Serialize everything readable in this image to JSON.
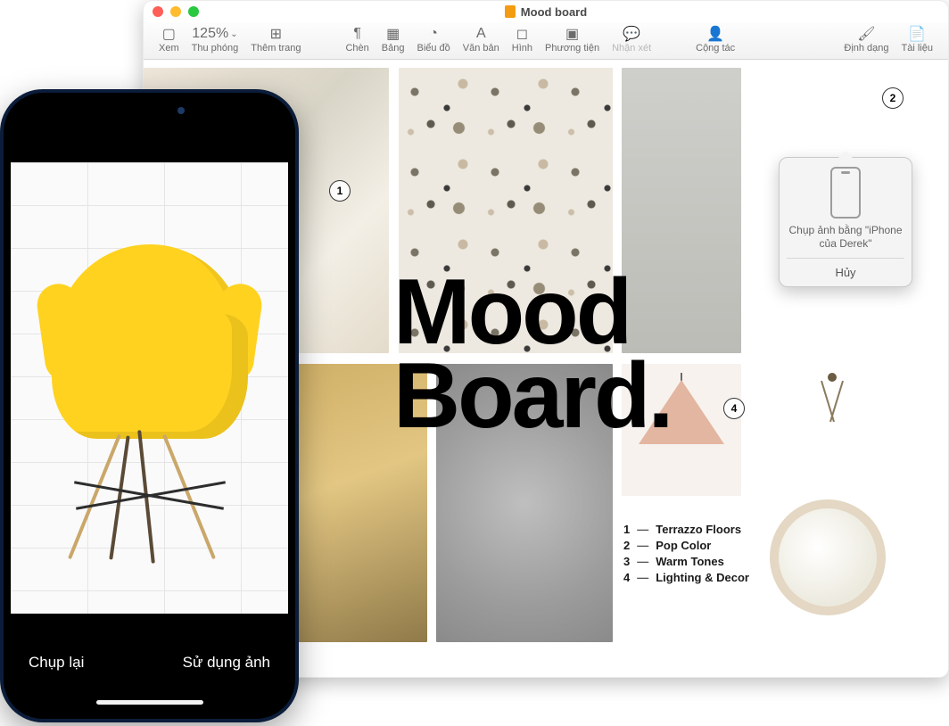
{
  "window": {
    "title": "Mood board",
    "traffic": {
      "close": "#ff5f57",
      "min": "#febc2e",
      "max": "#28c840"
    }
  },
  "toolbar": {
    "view": "Xem",
    "zoom_value": "125%",
    "zoom_label": "Thu phóng",
    "add_page": "Thêm trang",
    "insert": "Chèn",
    "table": "Bảng",
    "chart": "Biểu đồ",
    "text": "Văn bản",
    "shape": "Hình",
    "media": "Phương tiện",
    "comment": "Nhận xét",
    "collaborate": "Cộng tác",
    "format": "Định dạng",
    "document": "Tài liệu"
  },
  "headline": {
    "line1": "Mood",
    "line2": "Board."
  },
  "callouts": {
    "c1": "1",
    "c2": "2",
    "c4": "4"
  },
  "legend": {
    "rows": [
      {
        "n": "1",
        "label": "Terrazzo Floors"
      },
      {
        "n": "2",
        "label": "Pop Color"
      },
      {
        "n": "3",
        "label": "Warm Tones"
      },
      {
        "n": "4",
        "label": "Lighting & Decor"
      }
    ]
  },
  "popover": {
    "text": "Chụp ảnh bằng \"iPhone của Derek\"",
    "cancel": "Hủy"
  },
  "iphone": {
    "retake": "Chụp lại",
    "use": "Sử dụng ảnh"
  }
}
